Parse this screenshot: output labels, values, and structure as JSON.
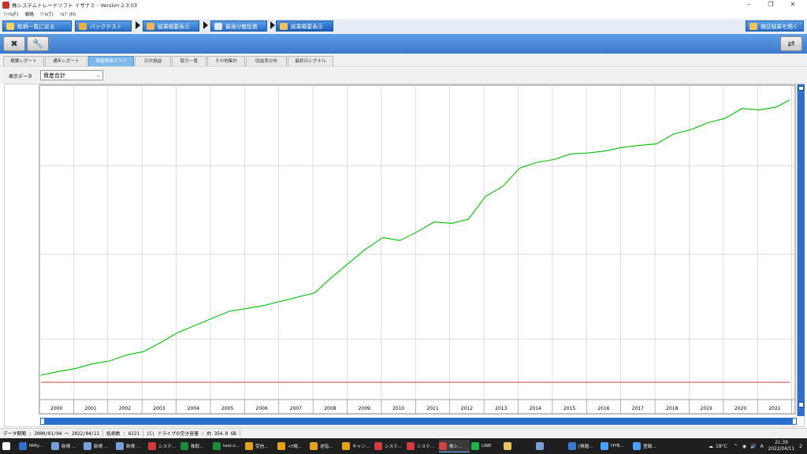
{
  "window": {
    "title": "株システムトレードソフト イザナミ - Version 2.3.03",
    "controls": {
      "minimize": "‒",
      "restore": "❐",
      "close": "✕"
    }
  },
  "menu": [
    "ﾌｧｲﾙ(F)",
    "戦略",
    "ﾂｰﾙ(T)",
    "ﾍﾙﾌﾟ(H)"
  ],
  "nav_tabs": [
    {
      "label": "銘柄一覧に戻る",
      "icon": "back-icon",
      "color": "#f4d36a"
    },
    {
      "label": "バックテスト",
      "icon": "cube-icon",
      "color": "#e8b04a"
    },
    {
      "label": "結果概要表示",
      "icon": "result-icon",
      "color": "#f0b45a"
    },
    {
      "label": "最適分散投資",
      "icon": "grid-icon",
      "color": "#dde7f5"
    },
    {
      "label": "結果概要表示",
      "icon": "chart-icon",
      "color": "#f0c060"
    }
  ],
  "open_result_button": {
    "label": "検証結果を開く",
    "icon": "folder-icon"
  },
  "tool_buttons": [
    {
      "icon": "close-file-icon",
      "glyph": "✖"
    },
    {
      "icon": "wrench-icon",
      "glyph": "🔧"
    },
    {
      "icon": "export-icon",
      "glyph": "⇄"
    }
  ],
  "sub_tabs": [
    "概要レポート",
    "通年レポート",
    "資産推移グラフ",
    "日次損益",
    "取引一覧",
    "その他集計",
    "収益率分布",
    "最終日シグナル"
  ],
  "active_sub_tab": 2,
  "selector": {
    "label": "表示データ",
    "value": "資産合計"
  },
  "chart_data": {
    "type": "line",
    "title": "",
    "xlabel": "",
    "ylabel": "",
    "x_ticks": [
      "2000",
      "2001",
      "2002",
      "2003",
      "2004",
      "2005",
      "2006",
      "2007",
      "2008",
      "2009",
      "2010",
      "2011",
      "2012",
      "2013",
      "2014",
      "2015",
      "2016",
      "2017",
      "2018",
      "2019",
      "2020",
      "2021"
    ],
    "ylim": [
      0,
      100
    ],
    "grid": true,
    "series": [
      {
        "color": "#00c000",
        "x": [
          2000.0,
          2000.5,
          2001.0,
          2001.5,
          2002.0,
          2002.5,
          2003.0,
          2003.5,
          2004.0,
          2004.5,
          2005.0,
          2005.5,
          2006.0,
          2006.5,
          2007.0,
          2007.5,
          2008.0,
          2008.5,
          2009.0,
          2009.5,
          2010.0,
          2010.5,
          2011.0,
          2011.5,
          2012.0,
          2012.5,
          2013.0,
          2013.5,
          2014.0,
          2014.5,
          2015.0,
          2015.5,
          2016.0,
          2016.5,
          2017.0,
          2017.5,
          2018.0,
          2018.5,
          2019.0,
          2019.5,
          2020.0,
          2020.5,
          2021.0,
          2021.5,
          2021.9
        ],
        "values": [
          2.5,
          3.8,
          4.8,
          6.5,
          7.5,
          9.6,
          10.8,
          14.0,
          17.5,
          20.0,
          22.5,
          25.0,
          26.0,
          27.0,
          28.5,
          30.0,
          31.5,
          37.0,
          42.0,
          47.0,
          51.0,
          50.0,
          53.0,
          56.5,
          56.0,
          57.5,
          65.5,
          69.0,
          75.5,
          77.5,
          78.5,
          80.5,
          80.8,
          81.5,
          82.8,
          83.5,
          84.0,
          87.5,
          89.0,
          91.5,
          93.0,
          96.5,
          96.0,
          97.0,
          99.5
        ]
      },
      {
        "color": "#c00000",
        "x": [
          2000.0,
          2021.9
        ],
        "values": [
          0.0,
          0.0
        ]
      }
    ]
  },
  "status": [
    "データ期間 : 2000/01/04 ～ 2022/04/11",
    "銘柄数 : 6221",
    "(C) ドライブの空き容量 : 約 354.0 GB"
  ],
  "taskbar": [
    {
      "label": "Nifty...",
      "color": "#2f6fd0"
    },
    {
      "label": "新規 ...",
      "color": "#7a9fd8"
    },
    {
      "label": "新規 ...",
      "color": "#7a9fd8"
    },
    {
      "label": "新規 ...",
      "color": "#7a9fd8"
    },
    {
      "label": "システ...",
      "color": "#d23b3b"
    },
    {
      "label": "株取...",
      "color": "#1e8a3c"
    },
    {
      "label": "test.x...",
      "color": "#1e8a3c"
    },
    {
      "label": "受信...",
      "color": "#e5a11e"
    },
    {
      "label": "<ﾓ眺...",
      "color": "#e5a11e"
    },
    {
      "label": "逆指...",
      "color": "#e5a11e"
    },
    {
      "label": "キャン...",
      "color": "#e5a11e"
    },
    {
      "label": "システ...",
      "color": "#d23b3b"
    },
    {
      "label": "システ...",
      "color": "#d23b3b"
    },
    {
      "label": "株シ...",
      "color": "#c44"
    },
    {
      "label": "LINE",
      "color": "#27b04a"
    },
    {
      "label": "",
      "color": "#e8c060"
    },
    {
      "label": "",
      "color": "#7a9fd8"
    },
    {
      "label": "[無題...",
      "color": "#3b78cf"
    },
    {
      "label": "HYB...",
      "color": "#4aa3ff"
    },
    {
      "label": "登録...",
      "color": "#4aa3ff"
    }
  ],
  "tray": {
    "temp": "18°C",
    "clock_time": "21:39",
    "clock_date": "2022/04/11",
    "ime": "A",
    "notif": "2"
  }
}
